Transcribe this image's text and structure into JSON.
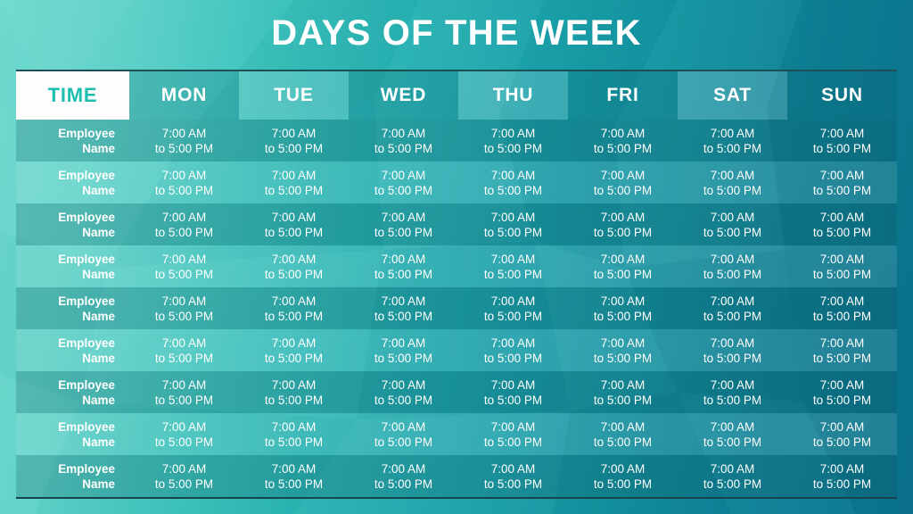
{
  "page": {
    "title": "DAYS OF THE WEEK",
    "accent_teal": "#1cbfad",
    "background_left": "#6fd9cf",
    "background_right": "#0c7590",
    "rule_color": "#1d4f55"
  },
  "table": {
    "headers": [
      {
        "label": "TIME",
        "style": "time"
      },
      {
        "label": "MON",
        "style": "dark"
      },
      {
        "label": "TUE",
        "style": "light"
      },
      {
        "label": "WED",
        "style": "dark"
      },
      {
        "label": "THU",
        "style": "light"
      },
      {
        "label": "FRI",
        "style": "dark"
      },
      {
        "label": "SAT",
        "style": "light"
      },
      {
        "label": "SUN",
        "style": "dark"
      }
    ],
    "name_line1": "Employee",
    "name_line2": "Name",
    "time_line1": "7:00 AM",
    "time_line2": "to 5:00 PM",
    "rows": [
      {
        "shade": "rdark",
        "name1": "Employee",
        "name2": "Name",
        "cells": [
          {
            "l1": "7:00 AM",
            "l2": "to 5:00 PM"
          },
          {
            "l1": "7:00 AM",
            "l2": "to 5:00 PM"
          },
          {
            "l1": "7:00 AM",
            "l2": "to 5:00 PM"
          },
          {
            "l1": "7:00 AM",
            "l2": "to 5:00 PM"
          },
          {
            "l1": "7:00 AM",
            "l2": "to 5:00 PM"
          },
          {
            "l1": "7:00 AM",
            "l2": "to 5:00 PM"
          },
          {
            "l1": "7:00 AM",
            "l2": "to 5:00 PM"
          }
        ]
      },
      {
        "shade": "rlight",
        "name1": "Employee",
        "name2": "Name",
        "cells": [
          {
            "l1": "7:00 AM",
            "l2": "to 5:00 PM"
          },
          {
            "l1": "7:00 AM",
            "l2": "to 5:00 PM"
          },
          {
            "l1": "7:00 AM",
            "l2": "to 5:00 PM"
          },
          {
            "l1": "7:00 AM",
            "l2": "to 5:00 PM"
          },
          {
            "l1": "7:00 AM",
            "l2": "to 5:00 PM"
          },
          {
            "l1": "7:00 AM",
            "l2": "to 5:00 PM"
          },
          {
            "l1": "7:00 AM",
            "l2": "to 5:00 PM"
          }
        ]
      },
      {
        "shade": "rdark",
        "name1": "Employee",
        "name2": "Name",
        "cells": [
          {
            "l1": "7:00 AM",
            "l2": "to 5:00 PM"
          },
          {
            "l1": "7:00 AM",
            "l2": "to 5:00 PM"
          },
          {
            "l1": "7:00 AM",
            "l2": "to 5:00 PM"
          },
          {
            "l1": "7:00 AM",
            "l2": "to 5:00 PM"
          },
          {
            "l1": "7:00 AM",
            "l2": "to 5:00 PM"
          },
          {
            "l1": "7:00 AM",
            "l2": "to 5:00 PM"
          },
          {
            "l1": "7:00 AM",
            "l2": "to 5:00 PM"
          }
        ]
      },
      {
        "shade": "rlight",
        "name1": "Employee",
        "name2": "Name",
        "cells": [
          {
            "l1": "7:00 AM",
            "l2": "to 5:00 PM"
          },
          {
            "l1": "7:00 AM",
            "l2": "to 5:00 PM"
          },
          {
            "l1": "7:00 AM",
            "l2": "to 5:00 PM"
          },
          {
            "l1": "7:00 AM",
            "l2": "to 5:00 PM"
          },
          {
            "l1": "7:00 AM",
            "l2": "to 5:00 PM"
          },
          {
            "l1": "7:00 AM",
            "l2": "to 5:00 PM"
          },
          {
            "l1": "7:00 AM",
            "l2": "to 5:00 PM"
          }
        ]
      },
      {
        "shade": "rdark",
        "name1": "Employee",
        "name2": "Name",
        "cells": [
          {
            "l1": "7:00 AM",
            "l2": "to 5:00 PM"
          },
          {
            "l1": "7:00 AM",
            "l2": "to 5:00 PM"
          },
          {
            "l1": "7:00 AM",
            "l2": "to 5:00 PM"
          },
          {
            "l1": "7:00 AM",
            "l2": "to 5:00 PM"
          },
          {
            "l1": "7:00 AM",
            "l2": "to 5:00 PM"
          },
          {
            "l1": "7:00 AM",
            "l2": "to 5:00 PM"
          },
          {
            "l1": "7:00 AM",
            "l2": "to 5:00 PM"
          }
        ]
      },
      {
        "shade": "rlight",
        "name1": "Employee",
        "name2": "Name",
        "cells": [
          {
            "l1": "7:00 AM",
            "l2": "to 5:00 PM"
          },
          {
            "l1": "7:00 AM",
            "l2": "to 5:00 PM"
          },
          {
            "l1": "7:00 AM",
            "l2": "to 5:00 PM"
          },
          {
            "l1": "7:00 AM",
            "l2": "to 5:00 PM"
          },
          {
            "l1": "7:00 AM",
            "l2": "to 5:00 PM"
          },
          {
            "l1": "7:00 AM",
            "l2": "to 5:00 PM"
          },
          {
            "l1": "7:00 AM",
            "l2": "to 5:00 PM"
          }
        ]
      },
      {
        "shade": "rdark",
        "name1": "Employee",
        "name2": "Name",
        "cells": [
          {
            "l1": "7:00 AM",
            "l2": "to 5:00 PM"
          },
          {
            "l1": "7:00 AM",
            "l2": "to 5:00 PM"
          },
          {
            "l1": "7:00 AM",
            "l2": "to 5:00 PM"
          },
          {
            "l1": "7:00 AM",
            "l2": "to 5:00 PM"
          },
          {
            "l1": "7:00 AM",
            "l2": "to 5:00 PM"
          },
          {
            "l1": "7:00 AM",
            "l2": "to 5:00 PM"
          },
          {
            "l1": "7:00 AM",
            "l2": "to 5:00 PM"
          }
        ]
      },
      {
        "shade": "rlight",
        "name1": "Employee",
        "name2": "Name",
        "cells": [
          {
            "l1": "7:00 AM",
            "l2": "to 5:00 PM"
          },
          {
            "l1": "7:00 AM",
            "l2": "to 5:00 PM"
          },
          {
            "l1": "7:00 AM",
            "l2": "to 5:00 PM"
          },
          {
            "l1": "7:00 AM",
            "l2": "to 5:00 PM"
          },
          {
            "l1": "7:00 AM",
            "l2": "to 5:00 PM"
          },
          {
            "l1": "7:00 AM",
            "l2": "to 5:00 PM"
          },
          {
            "l1": "7:00 AM",
            "l2": "to 5:00 PM"
          }
        ]
      },
      {
        "shade": "rdark",
        "name1": "Employee",
        "name2": "Name",
        "cells": [
          {
            "l1": "7:00 AM",
            "l2": "to 5:00 PM"
          },
          {
            "l1": "7:00 AM",
            "l2": "to 5:00 PM"
          },
          {
            "l1": "7:00 AM",
            "l2": "to 5:00 PM"
          },
          {
            "l1": "7:00 AM",
            "l2": "to 5:00 PM"
          },
          {
            "l1": "7:00 AM",
            "l2": "to 5:00 PM"
          },
          {
            "l1": "7:00 AM",
            "l2": "to 5:00 PM"
          },
          {
            "l1": "7:00 AM",
            "l2": "to 5:00 PM"
          }
        ]
      }
    ]
  }
}
